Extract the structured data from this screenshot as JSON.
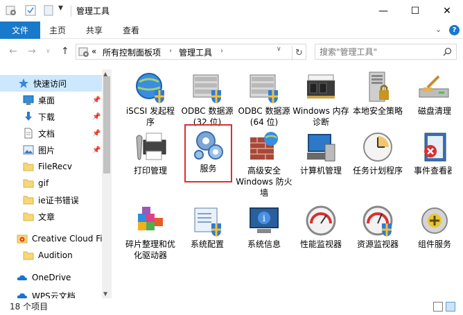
{
  "window": {
    "title": "管理工具",
    "minimize": "—",
    "maximize": "☐",
    "close": "✕"
  },
  "ribbon": {
    "tabs": [
      "文件",
      "主页",
      "共享",
      "查看"
    ],
    "collapse_symbol": "⌄",
    "help_symbol": "?"
  },
  "address": {
    "prefix": "«",
    "segments": [
      "所有控制面板项",
      "管理工具"
    ],
    "separator": "›"
  },
  "search": {
    "placeholder": "搜索\"管理工具\""
  },
  "nav": {
    "items": [
      {
        "label": "快速访问",
        "icon": "star-icon"
      },
      {
        "label": "桌面",
        "icon": "desktop-icon",
        "pinned": true
      },
      {
        "label": "下载",
        "icon": "download-icon",
        "pinned": true
      },
      {
        "label": "文档",
        "icon": "document-icon",
        "pinned": true
      },
      {
        "label": "图片",
        "icon": "picture-icon",
        "pinned": true
      },
      {
        "label": "FileRecv",
        "icon": "folder-icon"
      },
      {
        "label": "gif",
        "icon": "folder-icon"
      },
      {
        "label": "ie证书错误",
        "icon": "folder-icon"
      },
      {
        "label": "文章",
        "icon": "folder-icon"
      },
      {
        "label": "Creative Cloud Fil",
        "icon": "creative-cloud-icon"
      },
      {
        "label": "Audition",
        "icon": "folder-icon"
      },
      {
        "label": "OneDrive",
        "icon": "onedrive-icon"
      },
      {
        "label": "WPS云文档",
        "icon": "wps-cloud-icon"
      }
    ]
  },
  "items": [
    {
      "label": "iSCSI 发起程序",
      "icon": "iscsi-globe-icon"
    },
    {
      "label": "ODBC 数据源(32 位)",
      "icon": "odbc-32-icon"
    },
    {
      "label": "ODBC 数据源(64 位)",
      "icon": "odbc-64-icon"
    },
    {
      "label": "Windows 内存诊断",
      "icon": "memory-chip-icon"
    },
    {
      "label": "本地安全策略",
      "icon": "local-security-icon"
    },
    {
      "label": "磁盘清理",
      "icon": "disk-cleanup-icon"
    },
    {
      "label": "打印管理",
      "icon": "print-management-icon"
    },
    {
      "label": "服务",
      "icon": "services-gears-icon",
      "selected": true
    },
    {
      "label": "高级安全 Windows 防火墙",
      "icon": "firewall-icon"
    },
    {
      "label": "计算机管理",
      "icon": "computer-management-icon"
    },
    {
      "label": "任务计划程序",
      "icon": "task-scheduler-icon"
    },
    {
      "label": "事件查看器",
      "icon": "event-viewer-icon"
    },
    {
      "label": "碎片整理和优化驱动器",
      "icon": "defrag-icon"
    },
    {
      "label": "系统配置",
      "icon": "system-config-icon"
    },
    {
      "label": "系统信息",
      "icon": "system-info-icon"
    },
    {
      "label": "性能监视器",
      "icon": "performance-monitor-icon"
    },
    {
      "label": "资源监视器",
      "icon": "resource-monitor-icon"
    },
    {
      "label": "组件服务",
      "icon": "component-services-icon"
    }
  ],
  "status": {
    "item_count": "18 个项目"
  },
  "colors": {
    "accent": "#1979ca",
    "selection_outline": "#d9302f",
    "nav_selected": "#cce8ff",
    "folder": "#f8d775"
  }
}
